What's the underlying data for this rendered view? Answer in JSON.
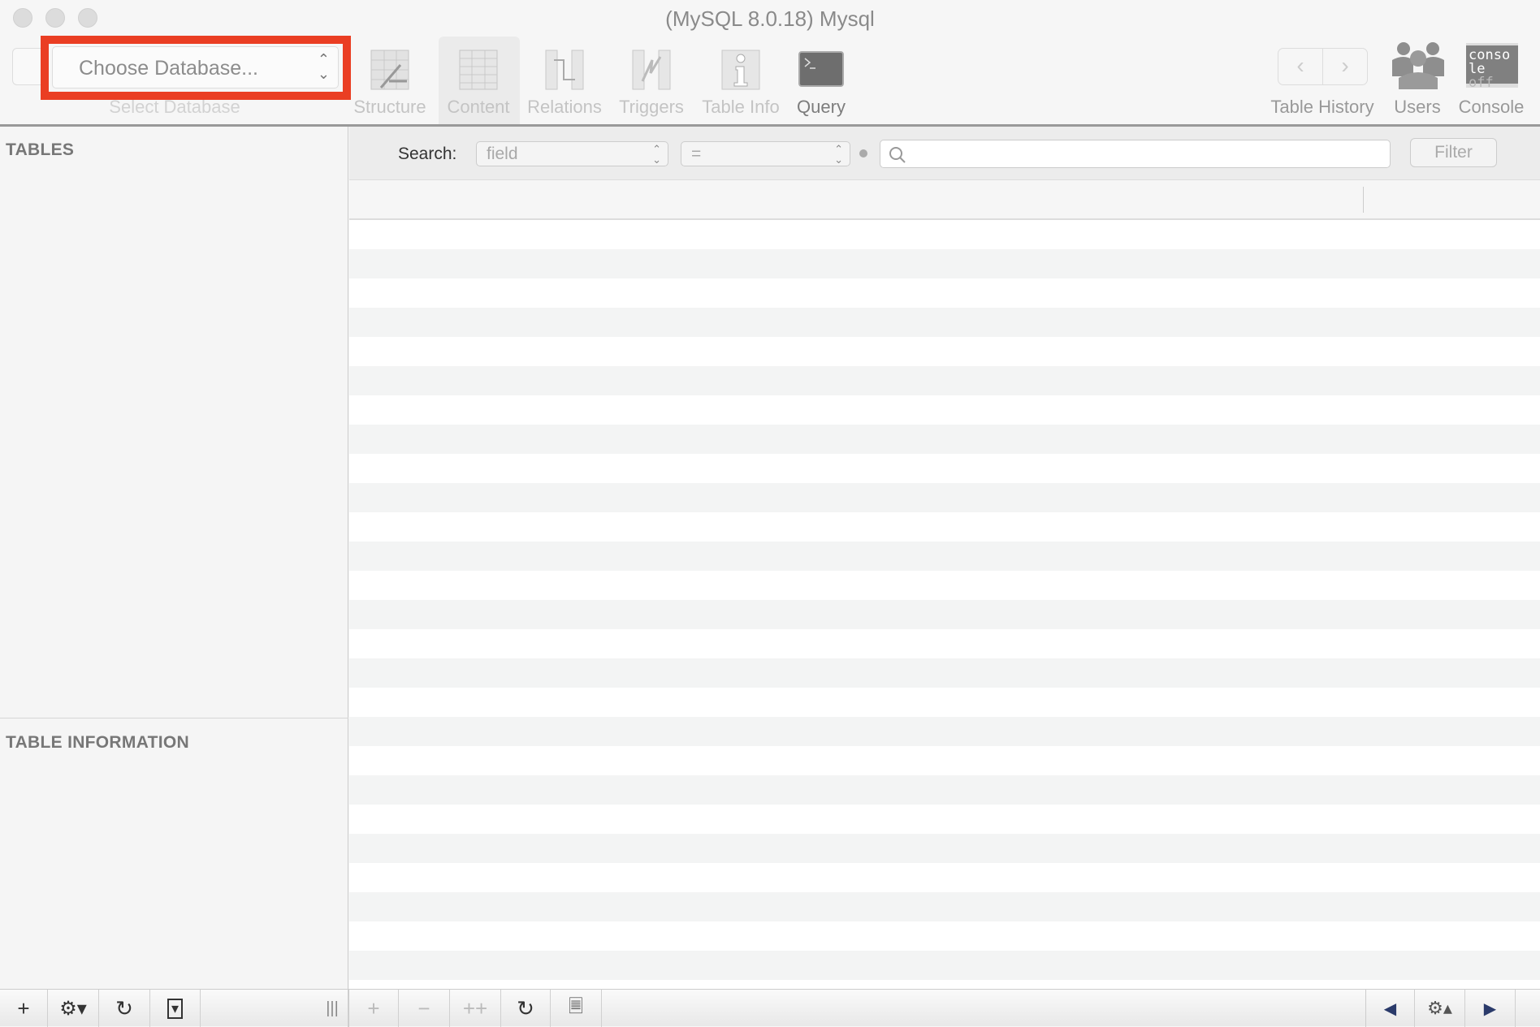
{
  "window": {
    "title": "(MySQL 8.0.18) Mysql"
  },
  "toolbar": {
    "database_popup": {
      "value": "Choose Database...",
      "label": "Select Database"
    },
    "items": [
      {
        "label": "Structure",
        "icon": "structure-icon",
        "enabled": false
      },
      {
        "label": "Content",
        "icon": "content-icon",
        "enabled": false,
        "selected": true
      },
      {
        "label": "Relations",
        "icon": "relations-icon",
        "enabled": false
      },
      {
        "label": "Triggers",
        "icon": "triggers-icon",
        "enabled": false
      },
      {
        "label": "Table Info",
        "icon": "table-info-icon",
        "enabled": false
      },
      {
        "label": "Query",
        "icon": "query-icon",
        "enabled": true
      }
    ],
    "history_label": "Table History",
    "users_label": "Users",
    "console_label": "Console",
    "console_icon_text": [
      "conso",
      "le",
      "off"
    ]
  },
  "sidebar": {
    "tables_header": "TABLES",
    "info_header": "TABLE INFORMATION"
  },
  "search": {
    "label": "Search:",
    "field_value": "field",
    "operator_value": "=",
    "input_value": "",
    "filter_label": "Filter"
  },
  "highlight_color": "#ea3e23"
}
